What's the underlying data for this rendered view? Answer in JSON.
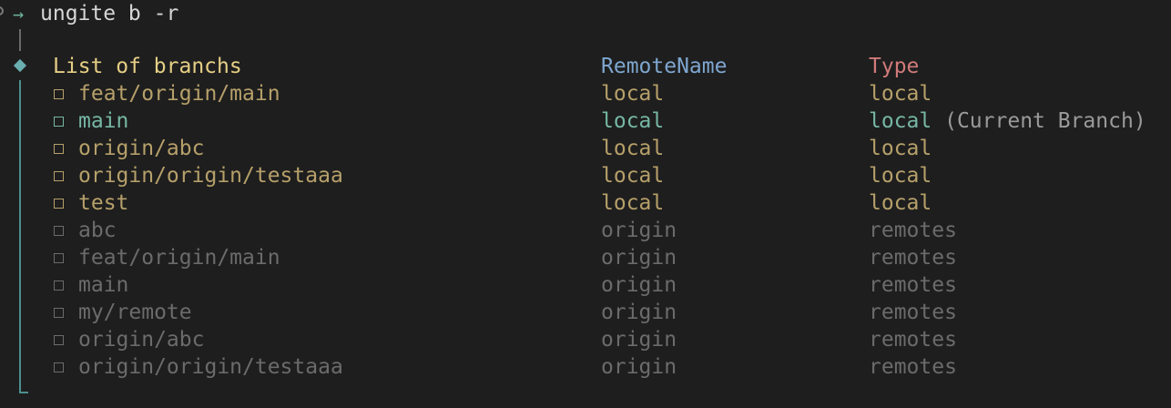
{
  "prompt": {
    "arrow": "→",
    "command": "ungite b -r"
  },
  "table": {
    "title": "List of branchs",
    "col_remote": "RemoteName",
    "col_type": "Type",
    "rows": [
      {
        "name": "feat/origin/main",
        "remote": "local",
        "type": "local",
        "note": "",
        "kind": "local"
      },
      {
        "name": "main",
        "remote": "local",
        "type": "local",
        "note": "(Current Branch)",
        "kind": "current"
      },
      {
        "name": "origin/abc",
        "remote": "local",
        "type": "local",
        "note": "",
        "kind": "local"
      },
      {
        "name": "origin/origin/testaaa",
        "remote": "local",
        "type": "local",
        "note": "",
        "kind": "local"
      },
      {
        "name": "test",
        "remote": "local",
        "type": "local",
        "note": "",
        "kind": "local"
      },
      {
        "name": "abc",
        "remote": "origin",
        "type": "remotes",
        "note": "",
        "kind": "remote"
      },
      {
        "name": "feat/origin/main",
        "remote": "origin",
        "type": "remotes",
        "note": "",
        "kind": "remote"
      },
      {
        "name": "main",
        "remote": "origin",
        "type": "remotes",
        "note": "",
        "kind": "remote"
      },
      {
        "name": "my/remote",
        "remote": "origin",
        "type": "remotes",
        "note": "",
        "kind": "remote"
      },
      {
        "name": "origin/abc",
        "remote": "origin",
        "type": "remotes",
        "note": "",
        "kind": "remote"
      },
      {
        "name": "origin/origin/testaaa",
        "remote": "origin",
        "type": "remotes",
        "note": "",
        "kind": "remote"
      }
    ]
  }
}
